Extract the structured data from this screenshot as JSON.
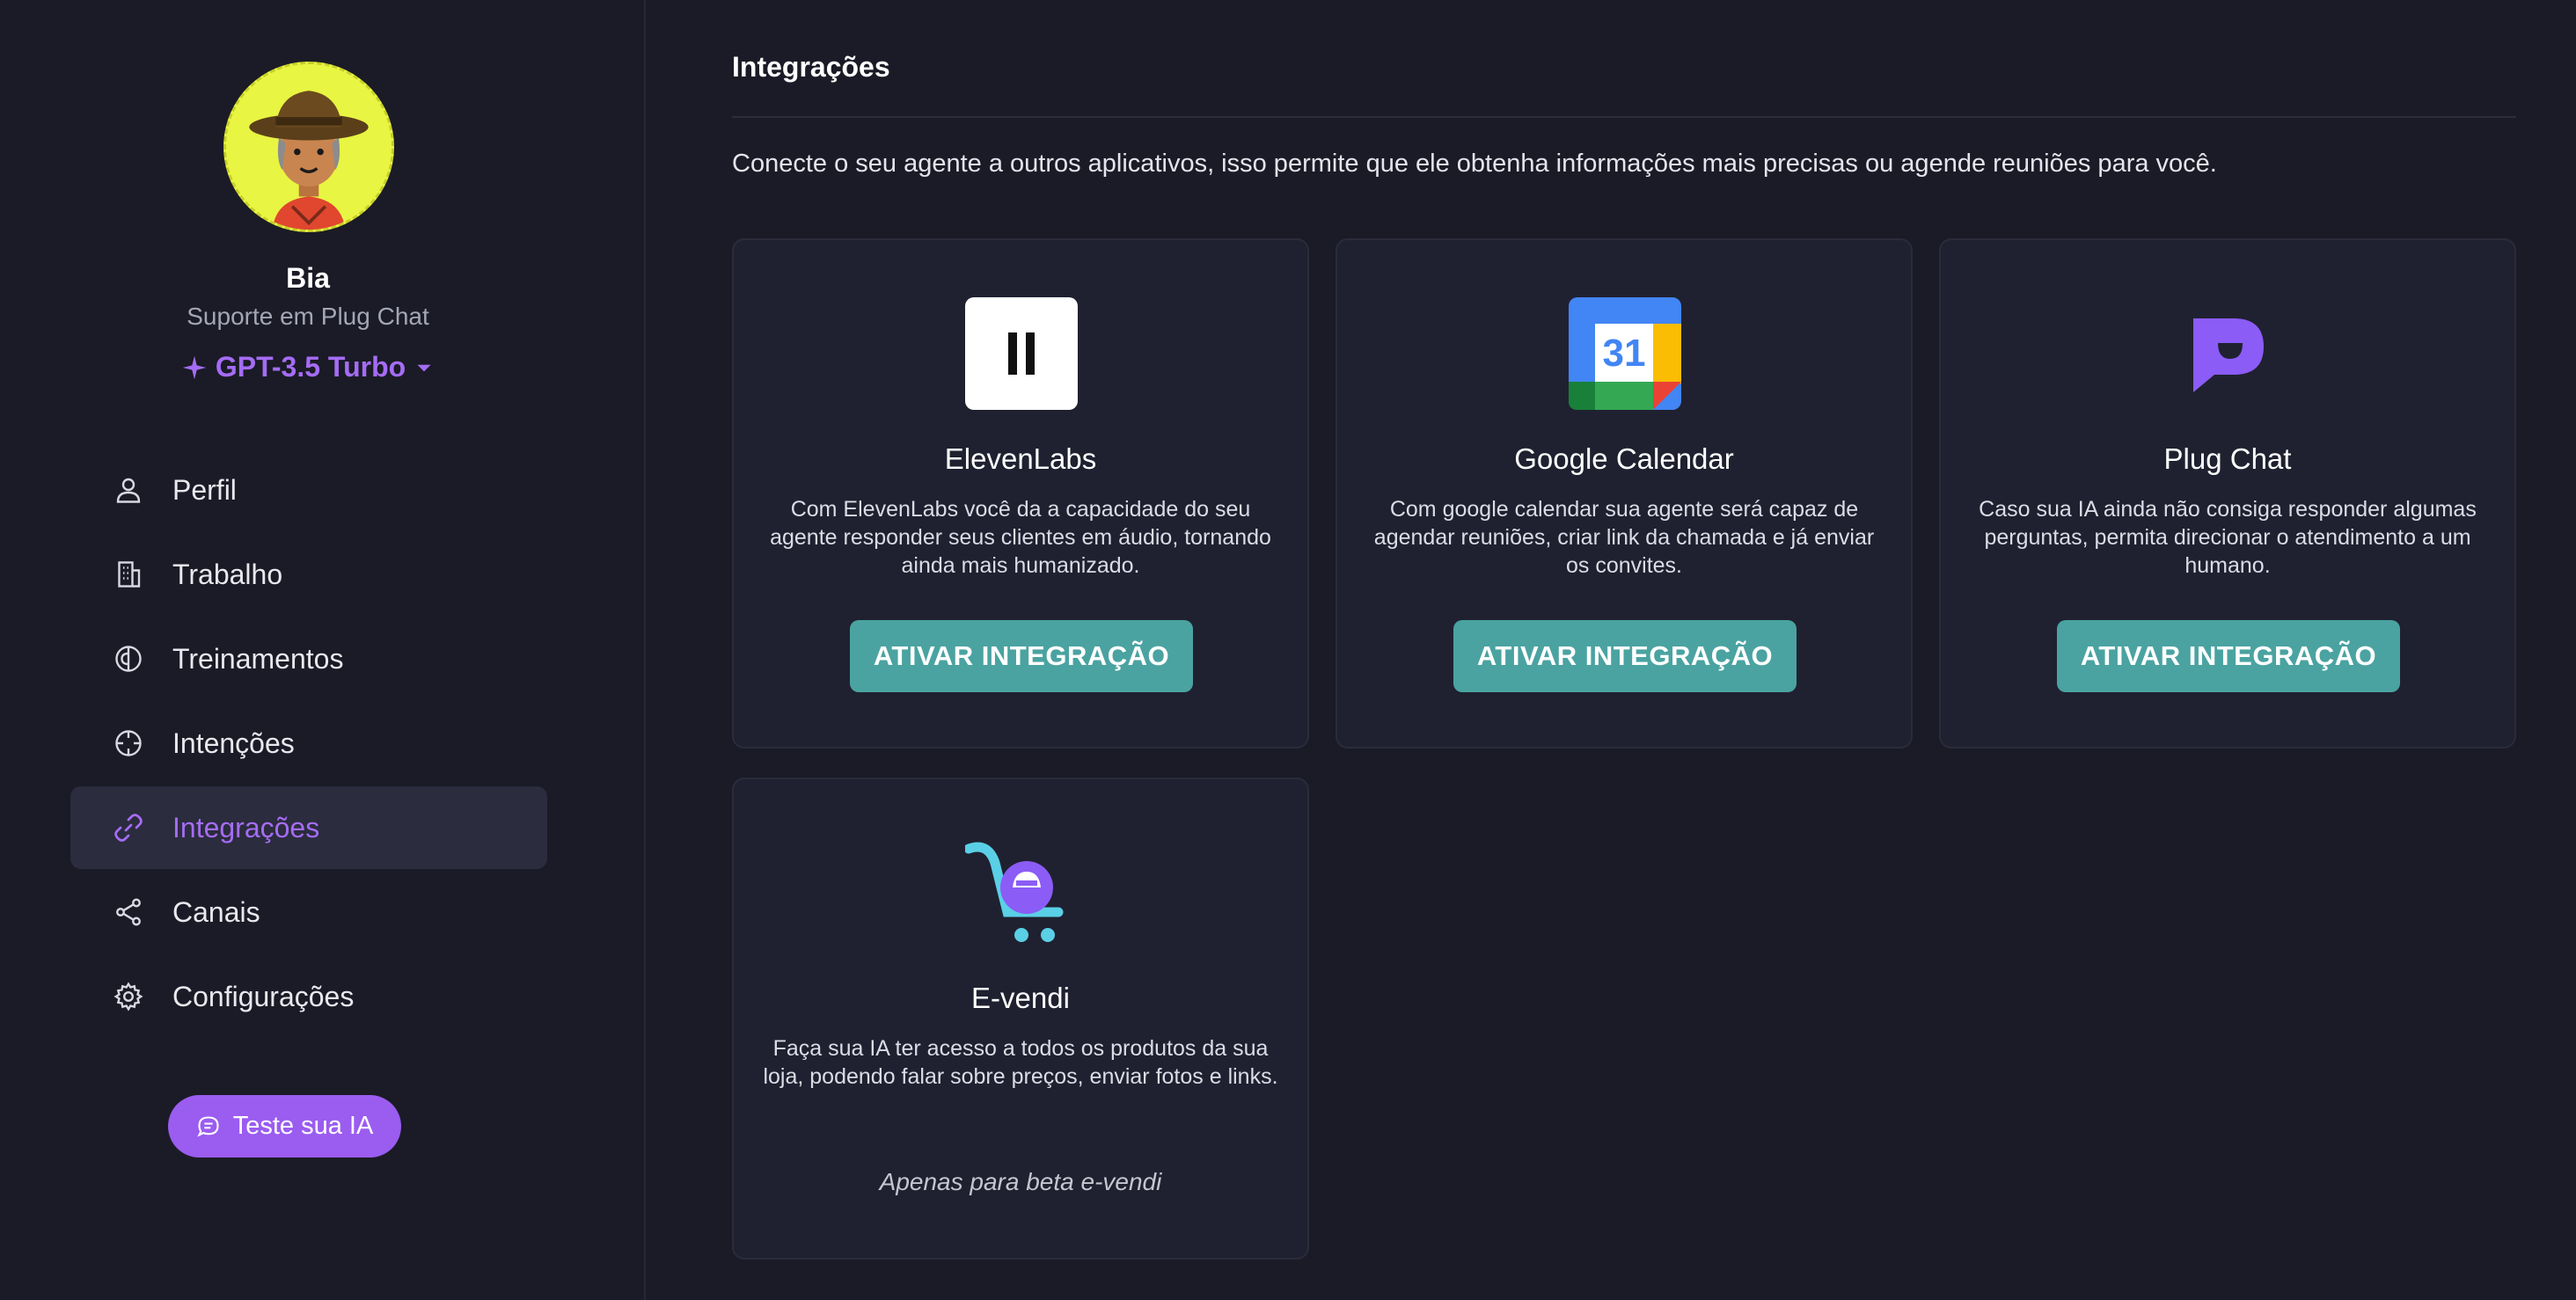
{
  "agent": {
    "name": "Bia",
    "role": "Suporte em Plug Chat",
    "model": "GPT-3.5 Turbo"
  },
  "nav": {
    "items": [
      {
        "label": "Perfil",
        "icon": "user-icon"
      },
      {
        "label": "Trabalho",
        "icon": "building-icon"
      },
      {
        "label": "Treinamentos",
        "icon": "brain-icon"
      },
      {
        "label": "Intenções",
        "icon": "crosshair-icon"
      },
      {
        "label": "Integrações",
        "icon": "link-icon",
        "active": true
      },
      {
        "label": "Canais",
        "icon": "share-icon"
      },
      {
        "label": "Configurações",
        "icon": "gear-icon"
      }
    ]
  },
  "test_button": {
    "label": "Teste sua IA",
    "icon": "chat-bubble-icon"
  },
  "page": {
    "title": "Integrações",
    "description": "Conecte o seu agente a outros aplicativos, isso permite que ele obtenha informações mais precisas ou agende reuniões para você."
  },
  "integrations": [
    {
      "name": "ElevenLabs",
      "icon": "elevenlabs-logo",
      "description": "Com ElevenLabs você da a capacidade do seu agente responder seus clientes em áudio, tornando ainda mais humanizado.",
      "button": "ATIVAR INTEGRAÇÃO"
    },
    {
      "name": "Google Calendar",
      "icon": "google-calendar-logo",
      "logo_text": "31",
      "description": "Com google calendar sua agente será capaz de agendar reuniões, criar link da chamada e já enviar os convites.",
      "button": "ATIVAR INTEGRAÇÃO"
    },
    {
      "name": "Plug Chat",
      "icon": "plug-chat-logo",
      "description": "Caso sua IA ainda não consiga responder algumas perguntas, permita direcionar o atendimento a um humano.",
      "button": "ATIVAR INTEGRAÇÃO"
    },
    {
      "name": "E-vendi",
      "icon": "e-vendi-logo",
      "description": "Faça sua IA ter acesso a todos os produtos da sua loja, podendo falar sobre preços, enviar fotos e links.",
      "note": "Apenas para beta e-vendi"
    }
  ],
  "colors": {
    "background": "#1a1b26",
    "card": "#1f2130",
    "accent": "#a56cf5",
    "button": "#4aa3a1",
    "nav_active_bg": "#2b2c3d"
  }
}
